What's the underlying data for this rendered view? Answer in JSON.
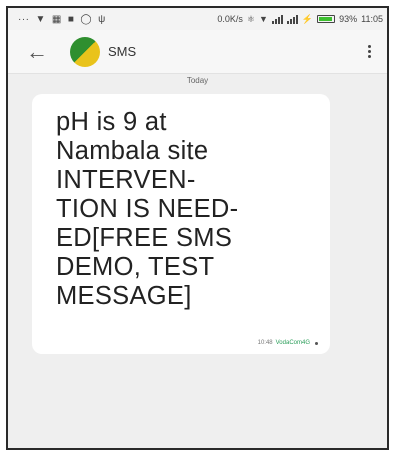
{
  "status_bar": {
    "speed": "0.0K/s",
    "battery": "93%",
    "battery_level": 0.93,
    "time": "11:05"
  },
  "app_bar": {
    "contact_name": "SMS"
  },
  "conversation": {
    "date_divider": "Today",
    "message": {
      "text": "pH is 9 at\nNambala site\nINTERVEN-\nTION IS NEED-\nED[FREE SMS\nDEMO, TEST\nMESSAGE]",
      "time": "10:48",
      "carrier": "VodaCom4G"
    }
  },
  "icons": {
    "back": "arrow-left-icon",
    "menu": "more-vert-icon"
  },
  "colors": {
    "carrier_text": "#2b9e5a",
    "battery": "#3cbf2e",
    "avatar_green": "#2f8f2f",
    "avatar_yellow": "#e9c31b"
  }
}
